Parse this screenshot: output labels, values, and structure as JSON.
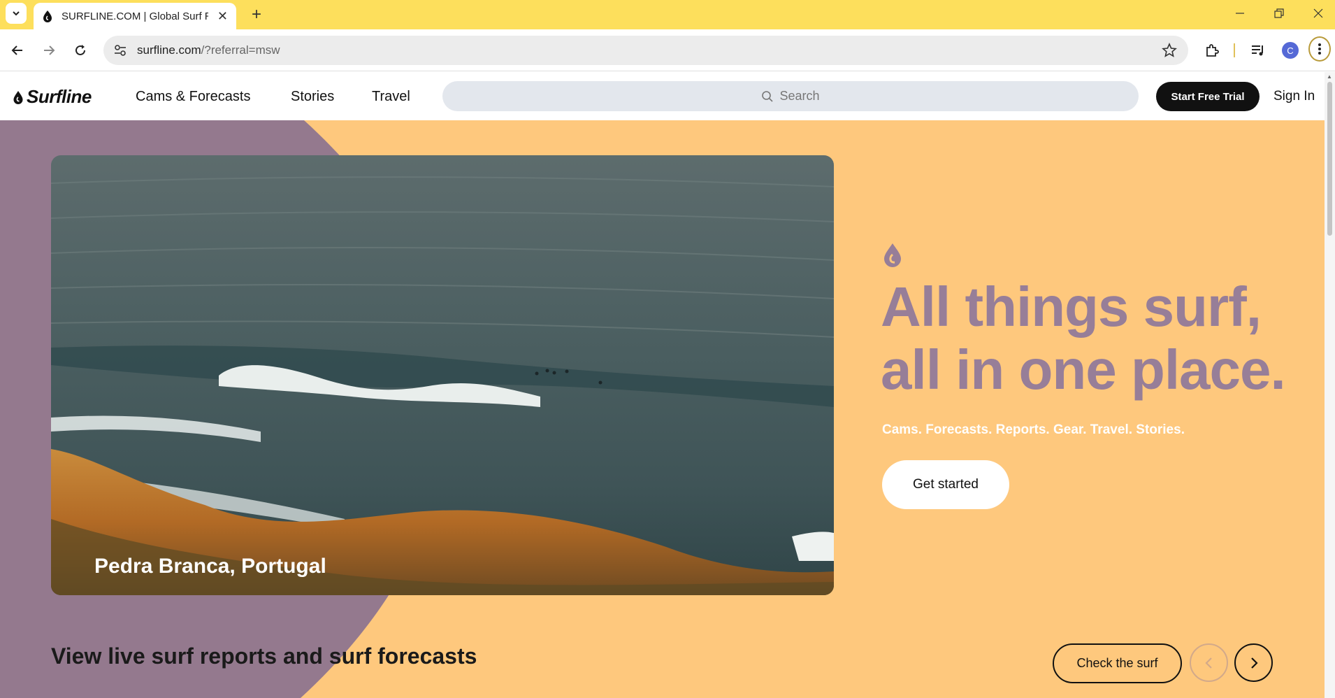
{
  "browser": {
    "tab_title": "SURFLINE.COM | Global Surf Re",
    "url_host": "surfline.com",
    "url_path": "/?referral=msw",
    "profile_initial": "C"
  },
  "site": {
    "logo_text": "Surfline",
    "nav": [
      "Cams & Forecasts",
      "Stories",
      "Travel"
    ],
    "search_placeholder": "Search",
    "trial_label": "Start Free Trial",
    "signin_label": "Sign In"
  },
  "hero": {
    "caption": "Pedra Branca, Portugal",
    "headline_line1": "All things surf,",
    "headline_line2": "all in one place.",
    "subline": "Cams. Forecasts. Reports. Gear. Travel. Stories.",
    "cta_label": "Get started"
  },
  "section": {
    "title": "View live surf reports and surf forecasts",
    "check_label": "Check the surf"
  },
  "colors": {
    "chrome_yellow": "#fddf5c",
    "hero_orange": "#fec87d",
    "hero_purple": "#94798e",
    "headline_purple": "#977e98"
  }
}
